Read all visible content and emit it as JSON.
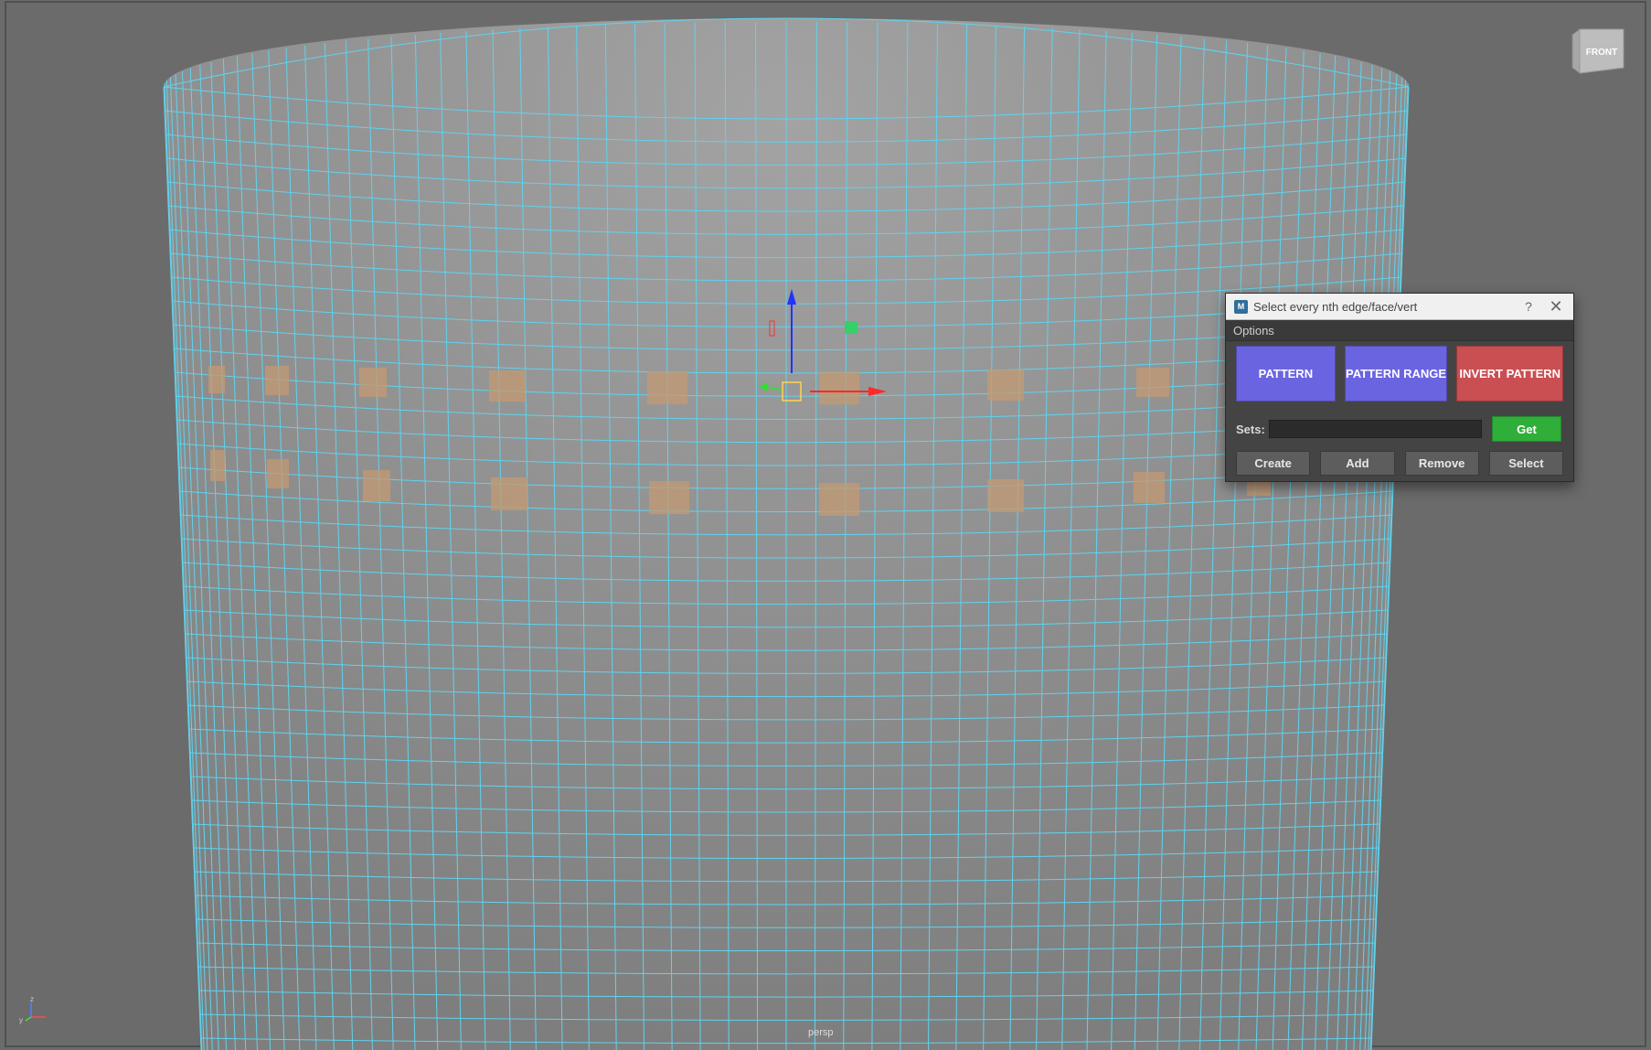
{
  "viewport": {
    "camera_label": "persp",
    "view_cube_label": "FRONT",
    "axis_labels": {
      "x": "x",
      "y": "y",
      "z": "z"
    },
    "colors": {
      "background": "#6b6b6b",
      "mesh_fill": "#8f8f8f",
      "wire": "#5fd3ee",
      "selected_face": "#c49a72"
    }
  },
  "dialog": {
    "title": "Select every nth edge/face/vert",
    "app_icon": "M",
    "help_label": "?",
    "close_label": "✕",
    "menu": {
      "options_label": "Options"
    },
    "buttons": {
      "pattern": "PATTERN",
      "pattern_range": "PATTERN RANGE",
      "invert_pattern": "INVERT PATTERN"
    },
    "sets": {
      "label": "Sets:",
      "value": "",
      "get_label": "Get"
    },
    "actions": {
      "create": "Create",
      "add": "Add",
      "remove": "Remove",
      "select": "Select"
    },
    "colors": {
      "pattern": "#6b64e0",
      "invert": "#c94f52",
      "get": "#2fae3a"
    }
  }
}
